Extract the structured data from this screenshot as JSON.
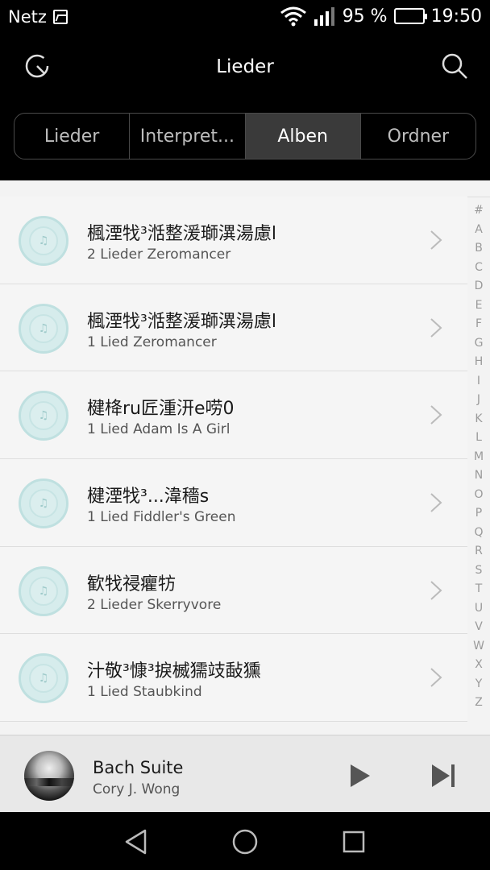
{
  "status_bar": {
    "carrier": "Netz",
    "battery": "95 %",
    "time": "19:50"
  },
  "header": {
    "title": "Lieder"
  },
  "tabs": [
    {
      "label": "Lieder",
      "active": false
    },
    {
      "label": "Interpret...",
      "active": false
    },
    {
      "label": "Alben",
      "active": true
    },
    {
      "label": "Ordner",
      "active": false
    }
  ],
  "albums": [
    {
      "title": "楓湮牫³湉整湲瑡潩湯慮l",
      "subtitle": "2 Lieder  Zeromancer"
    },
    {
      "title": "楓湮牫³湉整湲瑡潩湯慮l  ",
      "subtitle": "1 Lied  Zeromancer"
    },
    {
      "title": "楗栙ru匠湩汧e唠0",
      "subtitle": "1 Lied  Adam Is A Girl"
    },
    {
      "title": "楗湮牫³...湋穡s",
      "subtitle": "1 Lied  Fiddler's Green"
    },
    {
      "title": "歓牫祲癯牥",
      "subtitle": "2 Lieder  Skerryvore"
    },
    {
      "title": "汁敬³慷³捩楲獳攱敮獯",
      "subtitle": "1 Lied  Staubkind"
    }
  ],
  "alphabet_index": [
    "#",
    "A",
    "B",
    "C",
    "D",
    "E",
    "F",
    "G",
    "H",
    "I",
    "J",
    "K",
    "L",
    "M",
    "N",
    "O",
    "P",
    "Q",
    "R",
    "S",
    "T",
    "U",
    "V",
    "W",
    "X",
    "Y",
    "Z"
  ],
  "now_playing": {
    "title": "Bach Suite",
    "artist": "Cory J. Wong"
  }
}
